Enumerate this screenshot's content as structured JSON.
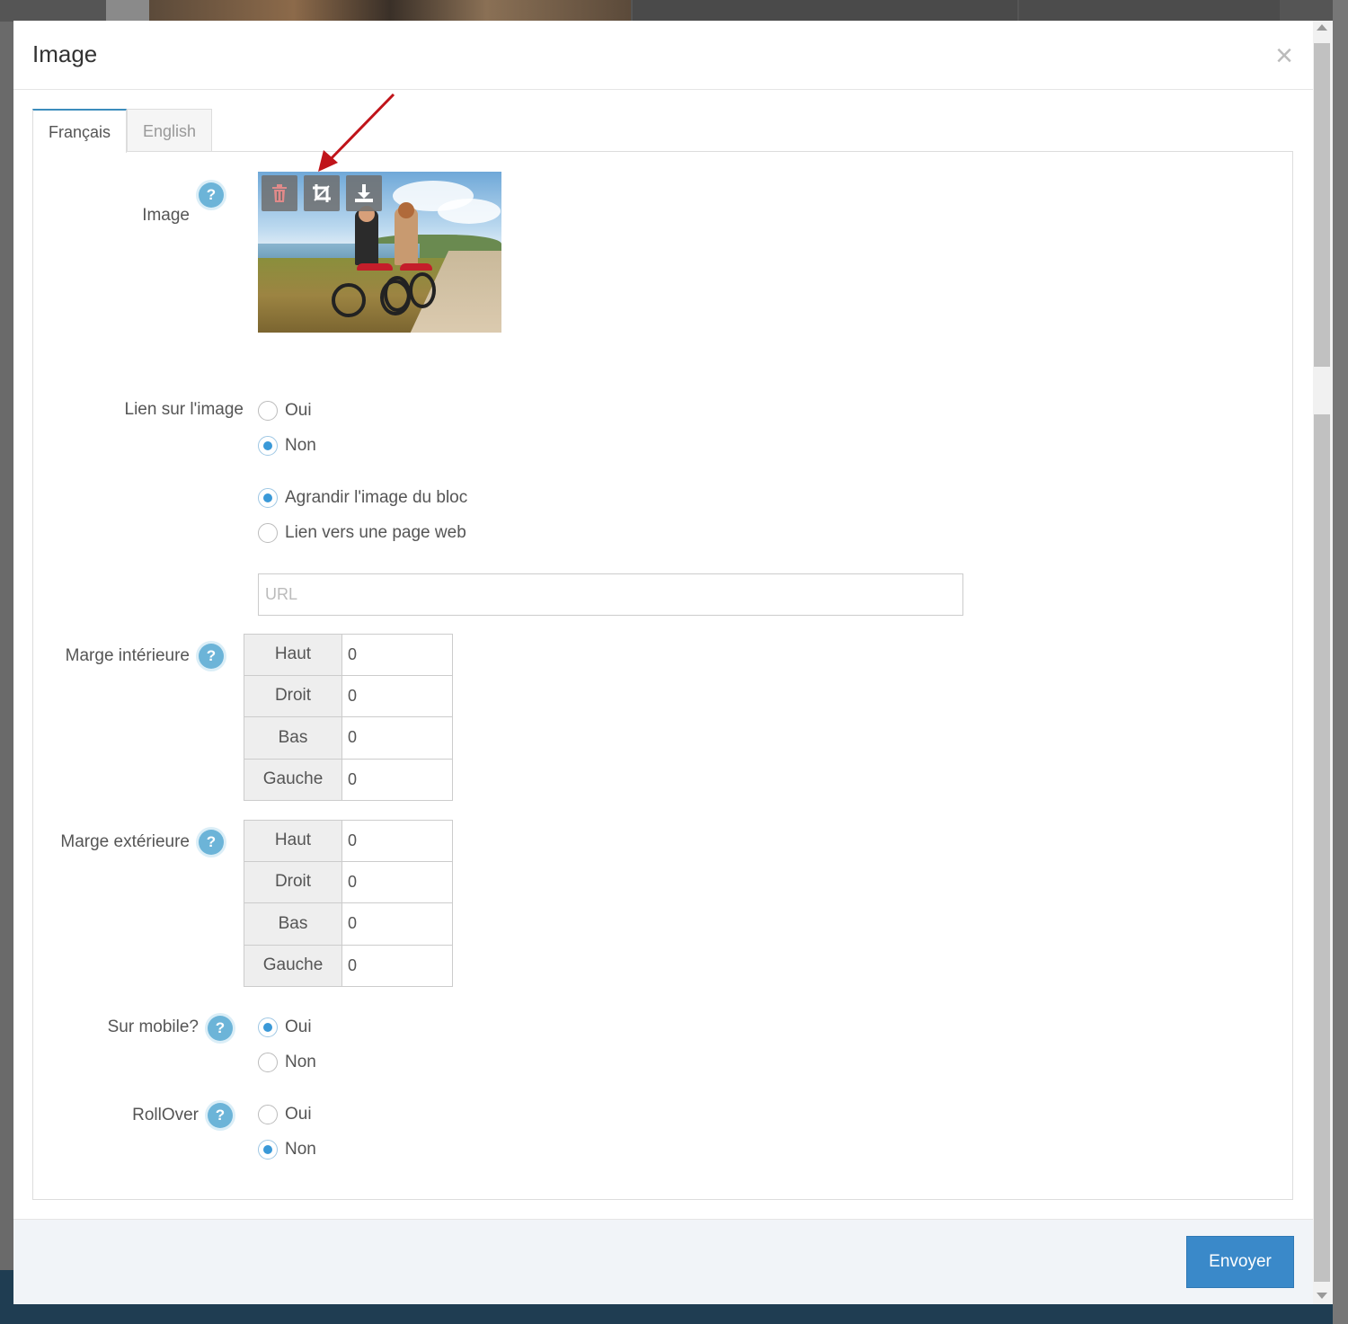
{
  "modal": {
    "title": "Image",
    "close_symbol": "×"
  },
  "tabs": [
    {
      "label": "Français",
      "active": true
    },
    {
      "label": "English",
      "active": false
    }
  ],
  "image_field": {
    "label": "Image",
    "help": "?",
    "tools": [
      "trash-icon",
      "crop-icon",
      "download-icon"
    ],
    "annotation_arrow_color": "#c0141a"
  },
  "link": {
    "label": "Lien sur l'image",
    "options": [
      {
        "label": "Oui",
        "checked": false
      },
      {
        "label": "Non",
        "checked": true
      }
    ],
    "sub_options": [
      {
        "label": "Agrandir l'image du bloc",
        "checked": true
      },
      {
        "label": "Lien vers une page web",
        "checked": false
      }
    ],
    "url_placeholder": "URL",
    "url_value": ""
  },
  "inner_margin": {
    "label": "Marge intérieure",
    "help": "?",
    "rows": [
      {
        "side": "Haut",
        "value": "0"
      },
      {
        "side": "Droit",
        "value": "0"
      },
      {
        "side": "Bas",
        "value": "0"
      },
      {
        "side": "Gauche",
        "value": "0"
      }
    ]
  },
  "outer_margin": {
    "label": "Marge extérieure",
    "help": "?",
    "rows": [
      {
        "side": "Haut",
        "value": "0"
      },
      {
        "side": "Droit",
        "value": "0"
      },
      {
        "side": "Bas",
        "value": "0"
      },
      {
        "side": "Gauche",
        "value": "0"
      }
    ]
  },
  "mobile": {
    "label": "Sur mobile?",
    "help": "?",
    "options": [
      {
        "label": "Oui",
        "checked": true
      },
      {
        "label": "Non",
        "checked": false
      }
    ]
  },
  "rollover": {
    "label": "RollOver",
    "help": "?",
    "options": [
      {
        "label": "Oui",
        "checked": false
      },
      {
        "label": "Non",
        "checked": true
      }
    ]
  },
  "footer": {
    "submit_label": "Envoyer"
  },
  "colors": {
    "accent": "#3a89c9",
    "help_badge": "#6cb4d8",
    "radio_checked": "#3a99d8"
  }
}
